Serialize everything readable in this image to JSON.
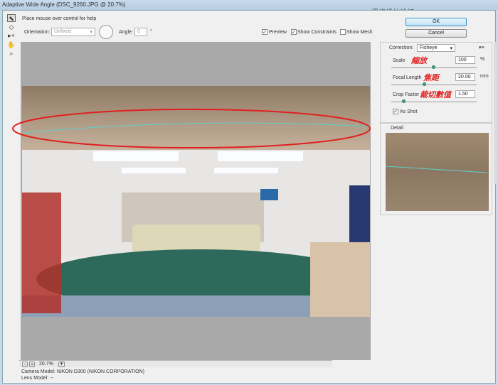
{
  "window": {
    "title": "Adaptive Wide Angle (DSC_9260.JPG @ 20.7%)",
    "watermark": "思缘设计论坛 WWW.MISSYUAN.COM"
  },
  "help_text": "Place mouse over control for help",
  "toolbar": {
    "orientation_label": "Orientation:",
    "orientation_value": "Unfixed",
    "angle_label": "Angle:",
    "angle_value": "0",
    "angle_unit": "°",
    "preview": {
      "label": "Preview",
      "checked": true
    },
    "show_constraints": {
      "label": "Show Constraints",
      "checked": true
    },
    "show_mesh": {
      "label": "Show Mesh",
      "checked": false
    }
  },
  "buttons": {
    "ok": "OK",
    "cancel": "Cancel"
  },
  "panel": {
    "correction_label": "Correction:",
    "correction_value": "Fisheye",
    "scale": {
      "label": "Scale",
      "annotation": "縮放",
      "value": "100",
      "unit": "%",
      "slider": 0.5
    },
    "focal": {
      "label": "Focal Length",
      "annotation": "焦距",
      "value": "20.00",
      "unit": "mm",
      "slider": 0.38
    },
    "crop": {
      "label": "Crop Factor",
      "annotation": "裁切數值",
      "value": "1.50",
      "slider": 0.12
    },
    "as_shot": {
      "label": "As Shot",
      "checked": true
    },
    "detail_label": "Detail"
  },
  "status": {
    "zoom": "20.7%",
    "camera": "Camera Model: NIKON D300 (NIKON CORPORATION)",
    "lens": "Lens Model: --"
  },
  "colors": {
    "constraint": "#5fd0c8",
    "ellipse": "#e02020"
  }
}
